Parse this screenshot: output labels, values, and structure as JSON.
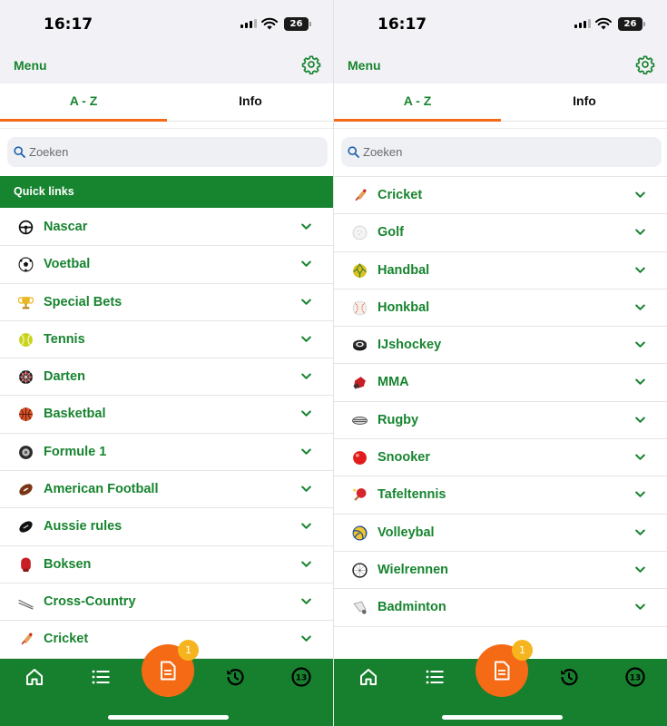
{
  "status": {
    "time": "16:17",
    "battery": "26"
  },
  "header": {
    "title": "Menu"
  },
  "tabs": {
    "az": "A - Z",
    "info": "Info"
  },
  "search": {
    "placeholder": "Zoeken"
  },
  "quick_links": "Quick links",
  "left_list": [
    {
      "label": "Nascar",
      "icon": "steering-wheel-icon"
    },
    {
      "label": "Voetbal",
      "icon": "soccer-ball-icon"
    },
    {
      "label": "Special Bets",
      "icon": "trophy-icon"
    },
    {
      "label": "Tennis",
      "icon": "tennis-ball-icon"
    },
    {
      "label": "Darten",
      "icon": "dartboard-icon"
    },
    {
      "label": "Basketbal",
      "icon": "basketball-icon"
    },
    {
      "label": "Formule 1",
      "icon": "tire-icon"
    },
    {
      "label": "American Football",
      "icon": "american-football-icon"
    },
    {
      "label": "Aussie rules",
      "icon": "aussie-rules-ball-icon"
    },
    {
      "label": "Boksen",
      "icon": "boxing-glove-icon"
    },
    {
      "label": "Cross-Country",
      "icon": "skis-icon"
    },
    {
      "label": "Cricket",
      "icon": "cricket-bat-icon"
    }
  ],
  "right_list": [
    {
      "label": "Cricket",
      "icon": "cricket-bat-icon"
    },
    {
      "label": "Golf",
      "icon": "golf-ball-icon"
    },
    {
      "label": "Handbal",
      "icon": "handball-icon"
    },
    {
      "label": "Honkbal",
      "icon": "baseball-icon"
    },
    {
      "label": "IJshockey",
      "icon": "hockey-puck-icon"
    },
    {
      "label": "MMA",
      "icon": "mma-glove-icon"
    },
    {
      "label": "Rugby",
      "icon": "rugby-ball-icon"
    },
    {
      "label": "Snooker",
      "icon": "snooker-ball-icon"
    },
    {
      "label": "Tafeltennis",
      "icon": "table-tennis-paddle-icon"
    },
    {
      "label": "Volleybal",
      "icon": "volleyball-icon"
    },
    {
      "label": "Wielrennen",
      "icon": "bicycle-wheel-icon"
    },
    {
      "label": "Badminton",
      "icon": "shuttlecock-icon"
    }
  ],
  "bottom_nav": {
    "betslip_badge": "1",
    "live_badge": "13"
  },
  "colors": {
    "brand_green": "#17842f",
    "accent_orange": "#f46a15",
    "badge_yellow": "#f6b51f",
    "header_bg": "#f2f2f6"
  }
}
